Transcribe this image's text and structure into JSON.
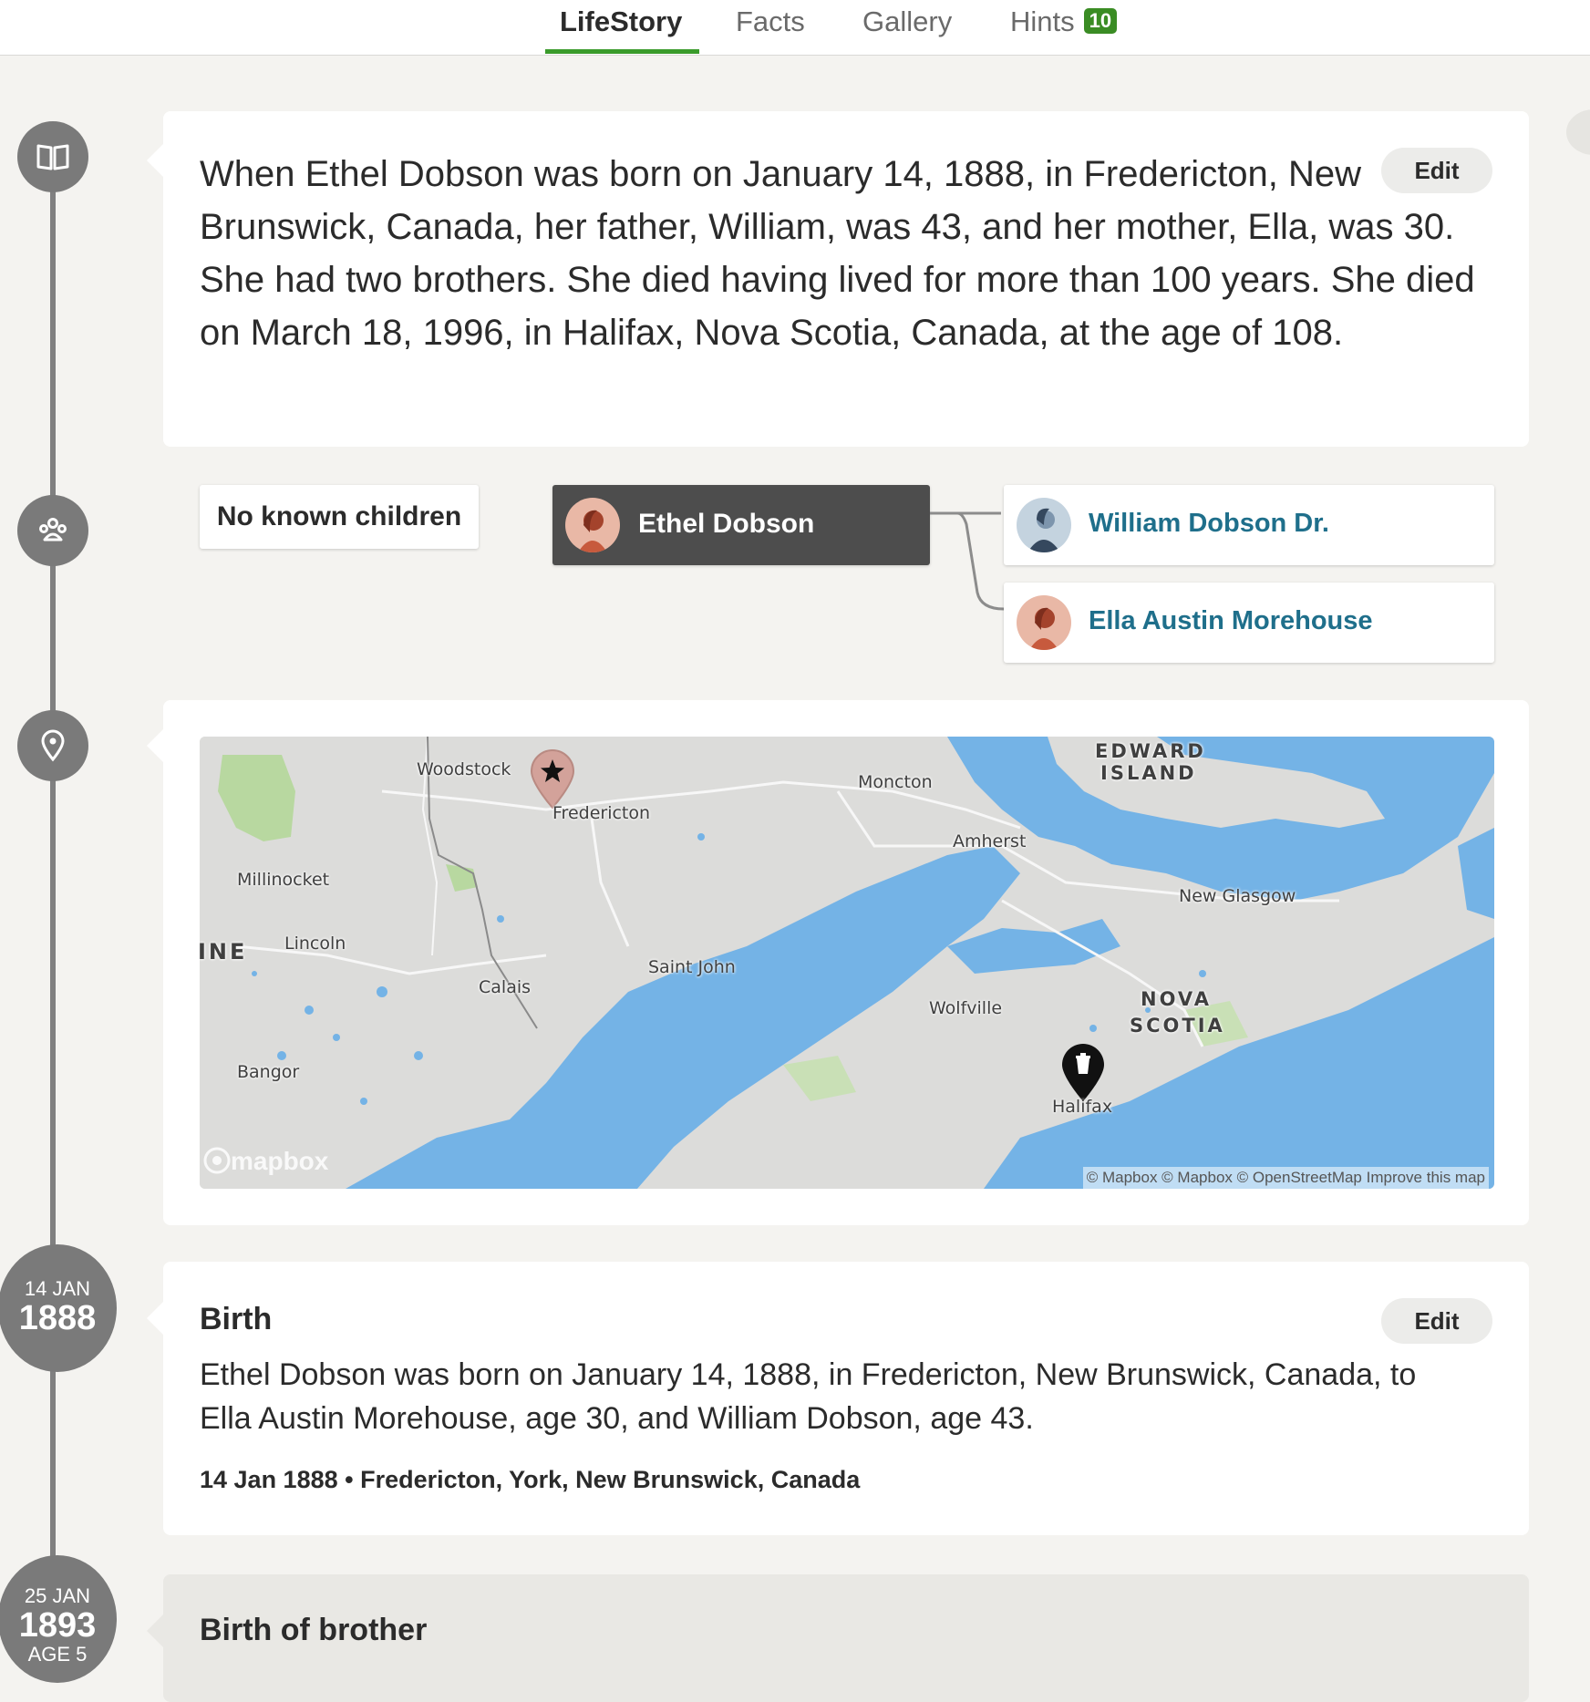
{
  "tabs": [
    {
      "label": "LifeStory"
    },
    {
      "label": "Facts"
    },
    {
      "label": "Gallery"
    },
    {
      "label": "Hints",
      "badge": "10"
    }
  ],
  "story": {
    "text": "When Ethel Dobson was born on January 14, 1888, in Fredericton, New Brunswick, Canada, her father, William, was 43, and her mother, Ella, was 30. She had two brothers. She died having lived for more than 100 years. She died on March 18, 1996, in Halifax, Nova Scotia, Canada, at the age of 108.",
    "edit_label": "Edit"
  },
  "family": {
    "children_label": "No known children",
    "self_name": "Ethel Dobson",
    "father_name": "William Dobson Dr.",
    "mother_name": "Ella Austin Morehouse"
  },
  "map": {
    "labels": {
      "woodstock": "Woodstock",
      "fredericton": "Fredericton",
      "moncton": "Moncton",
      "edward": "EDWARD",
      "island": "ISLAND",
      "amherst": "Amherst",
      "millinocket": "Millinocket",
      "new_glasgow": "New Glasgow",
      "ine": "INE",
      "lincoln": "Lincoln",
      "saint_john": "Saint John",
      "calais": "Calais",
      "wolfville": "Wolfville",
      "nova": "NOVA",
      "scotia": "SCOTIA",
      "bangor": "Bangor",
      "halifax": "Halifax"
    },
    "logo": "mapbox",
    "attribution": "© Mapbox © Mapbox © OpenStreetMap Improve this map",
    "colors": {
      "water": "#74b3e6",
      "land": "#dcdcda",
      "park": "#b8d8a0"
    }
  },
  "events": [
    {
      "day": "14 JAN",
      "year": "1888",
      "title": "Birth",
      "description": "Ethel Dobson was born on January 14, 1888, in Fredericton, New Brunswick, Canada, to Ella Austin Morehouse, age 30, and William Dobson, age 43.",
      "meta": "14 Jan 1888 • Fredericton, York, New Brunswick, Canada",
      "edit_label": "Edit"
    },
    {
      "day": "25 JAN",
      "year": "1893",
      "age": "AGE 5",
      "title": "Birth of brother"
    }
  ],
  "colors": {
    "accent": "#3a9b2b",
    "link": "#1f6f8b",
    "timeline": "#7a7a7a"
  }
}
